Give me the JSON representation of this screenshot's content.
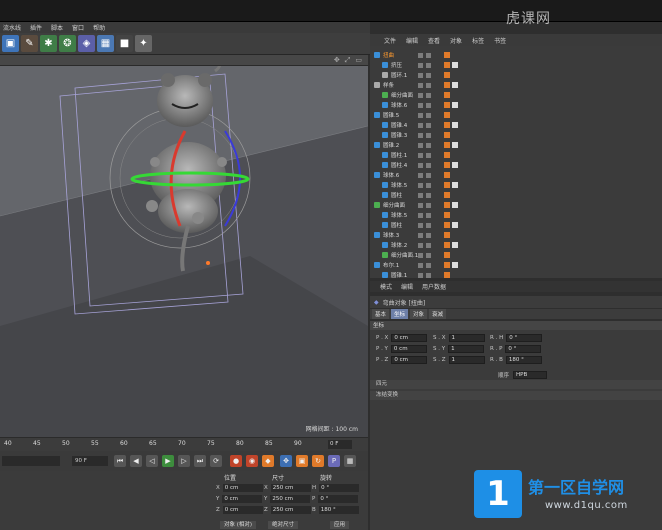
{
  "menu": {
    "items": [
      "流水线",
      "插件",
      "脚本",
      "窗口",
      "帮助"
    ]
  },
  "object_manager": {
    "menu": [
      "文件",
      "编辑",
      "查看",
      "对象",
      "标签",
      "书签"
    ],
    "rows": [
      {
        "name": "扭曲",
        "selected": true,
        "color": "#3a8fd8"
      },
      {
        "name": "挤压",
        "selected": false,
        "color": "#3a8fd8"
      },
      {
        "name": "圆环.1",
        "selected": false,
        "color": "#aaaaaa"
      },
      {
        "name": "样条",
        "selected": false,
        "color": "#aaaaaa"
      },
      {
        "name": "细分曲面",
        "selected": false,
        "color": "#4caf50"
      },
      {
        "name": "球体.6",
        "selected": false,
        "color": "#3a8fd8"
      },
      {
        "name": "圆锥.5",
        "selected": false,
        "color": "#3a8fd8"
      },
      {
        "name": "圆锥.4",
        "selected": false,
        "color": "#3a8fd8"
      },
      {
        "name": "圆锥.3",
        "selected": false,
        "color": "#3a8fd8"
      },
      {
        "name": "圆锥.2",
        "selected": false,
        "color": "#3a8fd8"
      },
      {
        "name": "圆柱.1",
        "selected": false,
        "color": "#3a8fd8"
      },
      {
        "name": "圆柱.4",
        "selected": false,
        "color": "#3a8fd8"
      },
      {
        "name": "球体.6",
        "selected": false,
        "color": "#3a8fd8"
      },
      {
        "name": "球体.5",
        "selected": false,
        "color": "#3a8fd8"
      },
      {
        "name": "圆柱",
        "selected": false,
        "color": "#3a8fd8"
      },
      {
        "name": "细分曲面",
        "selected": false,
        "color": "#4caf50"
      },
      {
        "name": "球体.5",
        "selected": false,
        "color": "#3a8fd8"
      },
      {
        "name": "圆柱",
        "selected": false,
        "color": "#3a8fd8"
      },
      {
        "name": "球体.3",
        "selected": false,
        "color": "#3a8fd8"
      },
      {
        "name": "球体.2",
        "selected": false,
        "color": "#3a8fd8"
      },
      {
        "name": "细分曲面.1",
        "selected": false,
        "color": "#4caf50"
      },
      {
        "name": "布尔.1",
        "selected": false,
        "color": "#3a8fd8"
      },
      {
        "name": "圆锥.1",
        "selected": false,
        "color": "#3a8fd8"
      }
    ]
  },
  "attributes": {
    "tabs": [
      "模式",
      "编辑",
      "用户数据"
    ],
    "title": "弯曲对象 [扭曲]",
    "subtabs": [
      "基本",
      "坐标",
      "对象",
      "衰减"
    ],
    "active_subtab": "坐标",
    "section": "坐标",
    "pos": [
      {
        "axis": "P . X",
        "value": "0 cm"
      },
      {
        "axis": "P . Y",
        "value": "0 cm"
      },
      {
        "axis": "P . Z",
        "value": "0 cm"
      }
    ],
    "scale": [
      {
        "axis": "S . X",
        "value": "1"
      },
      {
        "axis": "S . Y",
        "value": "1"
      },
      {
        "axis": "S . Z",
        "value": "1"
      }
    ],
    "rot": [
      {
        "axis": "R . H",
        "value": "0 °"
      },
      {
        "axis": "R . P",
        "value": "0 °"
      },
      {
        "axis": "R . B",
        "value": "180 °"
      }
    ],
    "order_label": "顺序",
    "order_value": "HPB",
    "fold1": "四元",
    "fold2": "冻结变换"
  },
  "viewport": {
    "grid_label": "网格间距 : 100 cm"
  },
  "timeline": {
    "ticks": [
      "40",
      "45",
      "50",
      "55",
      "60",
      "65",
      "70",
      "75",
      "80",
      "85",
      "90"
    ],
    "current_frame": "0 F",
    "end_frame": "90 F"
  },
  "coord_manager": {
    "headers": [
      "位置",
      "尺寸",
      "旋转"
    ],
    "rows": [
      {
        "p_axis": "X",
        "p": "0 cm",
        "s_axis": "X",
        "s": "250 cm",
        "r_axis": "H",
        "r": "0 °"
      },
      {
        "p_axis": "Y",
        "p": "0 cm",
        "s_axis": "Y",
        "s": "250 cm",
        "r_axis": "P",
        "r": "0 °"
      },
      {
        "p_axis": "Z",
        "p": "0 cm",
        "s_axis": "Z",
        "s": "250 cm",
        "r_axis": "B",
        "r": "180 °"
      }
    ],
    "object_mode": "对象 (相对)",
    "size_mode": "绝对尺寸",
    "apply": "应用"
  },
  "watermark": {
    "top": "虎课网",
    "title": "第一区自学网",
    "url": "www.d1qu.com",
    "logo": "1"
  },
  "colors": {
    "accent": "#ff9b2f",
    "selection": "#6d7fa8",
    "logo_blue": "#1e8fe6"
  }
}
